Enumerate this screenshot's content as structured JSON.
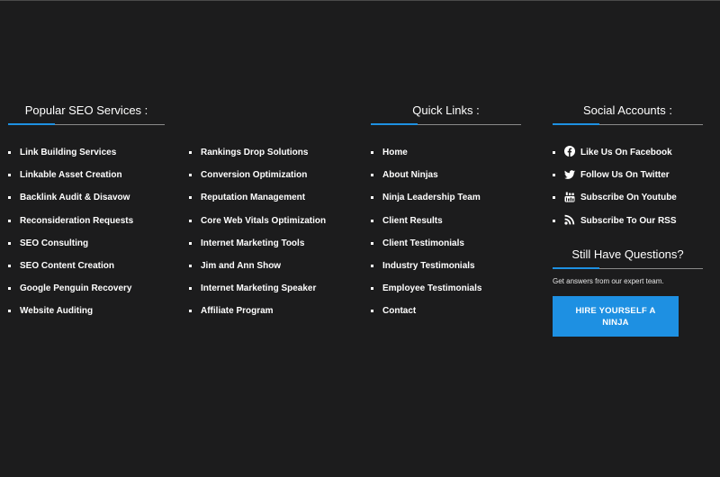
{
  "services": {
    "heading": "Popular SEO Services :",
    "column_a": [
      "Link Building Services",
      "Linkable Asset Creation",
      "Backlink Audit & Disavow",
      "Reconsideration Requests",
      "SEO Consulting",
      "SEO Content Creation",
      "Google Penguin Recovery",
      "Website Auditing"
    ],
    "column_b": [
      "Rankings Drop Solutions",
      "Conversion Optimization",
      "Reputation Management",
      "Core Web Vitals Optimization",
      "Internet Marketing Tools",
      "Jim and Ann Show",
      "Internet Marketing Speaker",
      "Affiliate Program"
    ]
  },
  "quick_links": {
    "heading": "Quick Links :",
    "items": [
      "Home",
      "About Ninjas",
      "Ninja Leadership Team",
      "Client Results",
      "Client Testimonials",
      "Industry Testimonials",
      "Employee Testimonials",
      "Contact"
    ]
  },
  "social": {
    "heading": "Social Accounts :",
    "items": [
      {
        "label": "Like Us On Facebook",
        "icon": "facebook-icon"
      },
      {
        "label": "Follow Us On Twitter",
        "icon": "twitter-icon"
      },
      {
        "label": "Subscribe On Youtube",
        "icon": "youtube-icon"
      },
      {
        "label": "Subscribe To Our RSS",
        "icon": "rss-icon"
      }
    ]
  },
  "questions": {
    "heading": "Still Have Questions?",
    "subtext": "Get answers from our expert team.",
    "button_label": "HIRE YOURSELF A NINJA"
  },
  "colors": {
    "background": "#1c1c1d",
    "accent": "#1e90e2",
    "text": "#ffffff"
  }
}
